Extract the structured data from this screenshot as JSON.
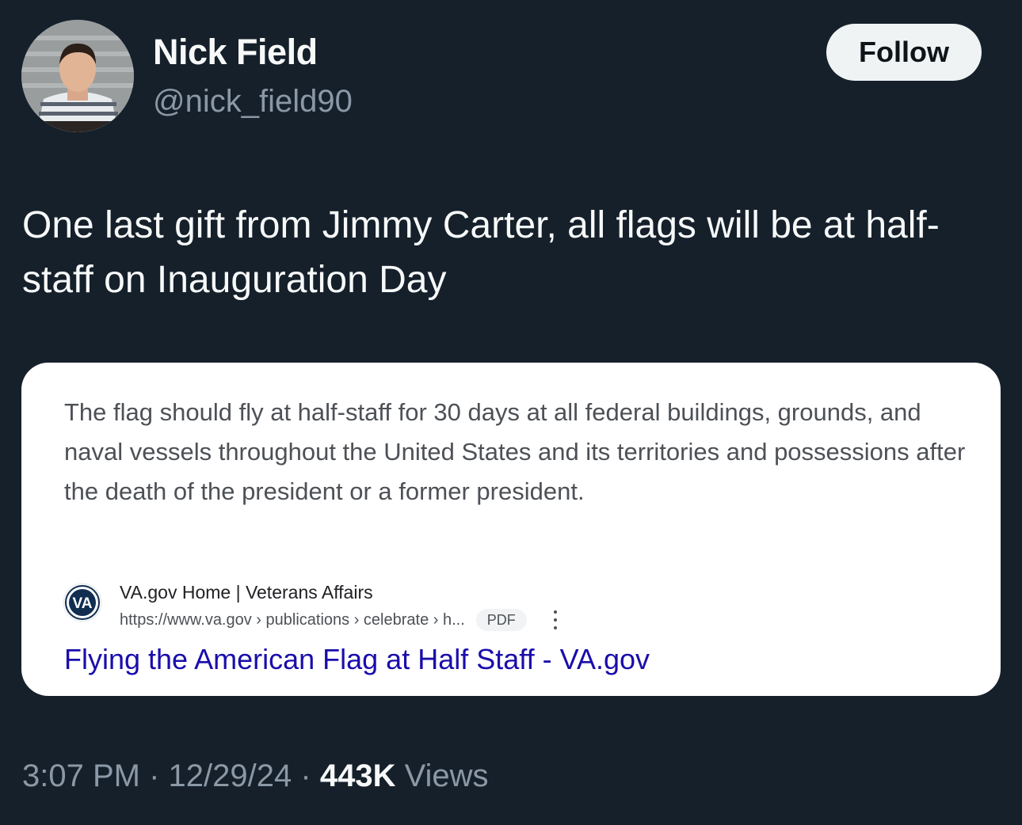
{
  "author": {
    "name": "Nick Field",
    "handle": "@nick_field90"
  },
  "follow_label": "Follow",
  "tweet_text": "One last gift from Jimmy Carter, all flags will be at half-staff on Inauguration Day",
  "card": {
    "snippet": "The flag should fly at half-staff for 30 days at all federal buildings, grounds, and naval vessels throughout the United States and its territories and possessions after the death of the president or a former president.",
    "source_icon_text": "VA",
    "site_name": "VA.gov Home | Veterans Affairs",
    "url": "https://www.va.gov › publications › celebrate › h...",
    "badge": "PDF",
    "link_title": "Flying the American Flag at Half Staff - VA.gov"
  },
  "meta": {
    "time": "3:07 PM",
    "separator": "·",
    "date": "12/29/24",
    "views_count": "443K",
    "views_label": "Views"
  },
  "colors": {
    "background": "#15202b",
    "link": "#1a0dab",
    "muted": "#8b98a5"
  }
}
